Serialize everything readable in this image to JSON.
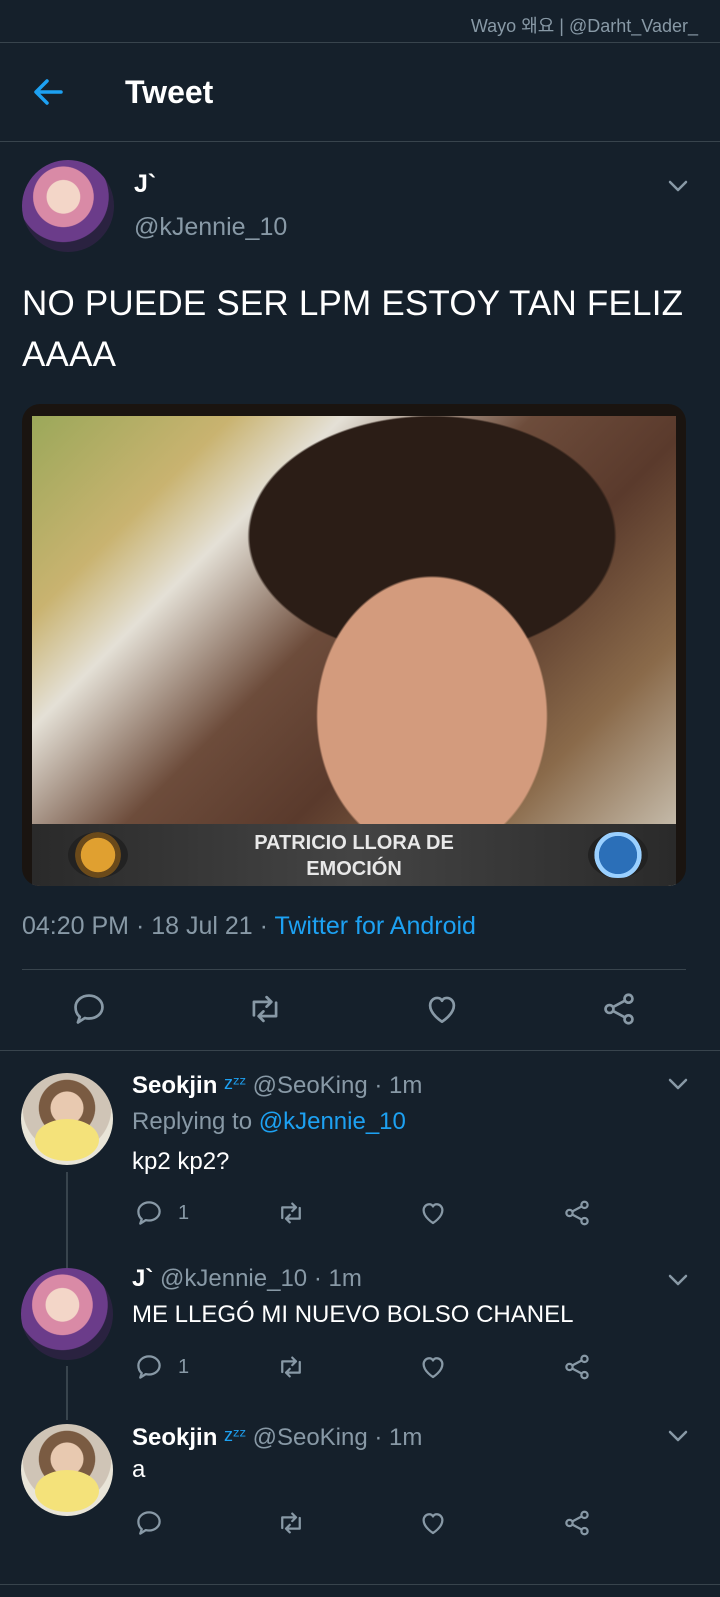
{
  "watermark": "Wayo 왜요 | @Darht_Vader_",
  "header": {
    "title": "Tweet"
  },
  "tweet": {
    "name": "J`",
    "handle": "@kJennie_10",
    "text": "NO PUEDE SER LPM ESTOY TAN FELIZ AAAA",
    "media_caption_line1": "PATRICIO LLORA DE",
    "media_caption_line2": "EMOCIÓN",
    "time": "04:20 PM",
    "date": "18 Jul 21",
    "source": "Twitter for Android"
  },
  "replies": [
    {
      "name": "Seokjin",
      "zzz": "zᶻᶻ",
      "handle": "@SeoKing",
      "time": "1m",
      "replying_to_label": "Replying to",
      "replying_to": "@kJennie_10",
      "text": "kp2 kp2?",
      "reply_count": "1"
    },
    {
      "name": "J`",
      "handle": "@kJennie_10",
      "time": "1m",
      "text": "ME LLEGÓ MI NUEVO BOLSO CHANEL",
      "reply_count": "1"
    },
    {
      "name": "Seokjin",
      "zzz": "zᶻᶻ",
      "handle": "@SeoKing",
      "time": "1m",
      "text": "a"
    }
  ],
  "colors": {
    "background": "#15202b",
    "accent": "#1da1f2",
    "muted": "#8899a6",
    "divider": "#38444d"
  }
}
